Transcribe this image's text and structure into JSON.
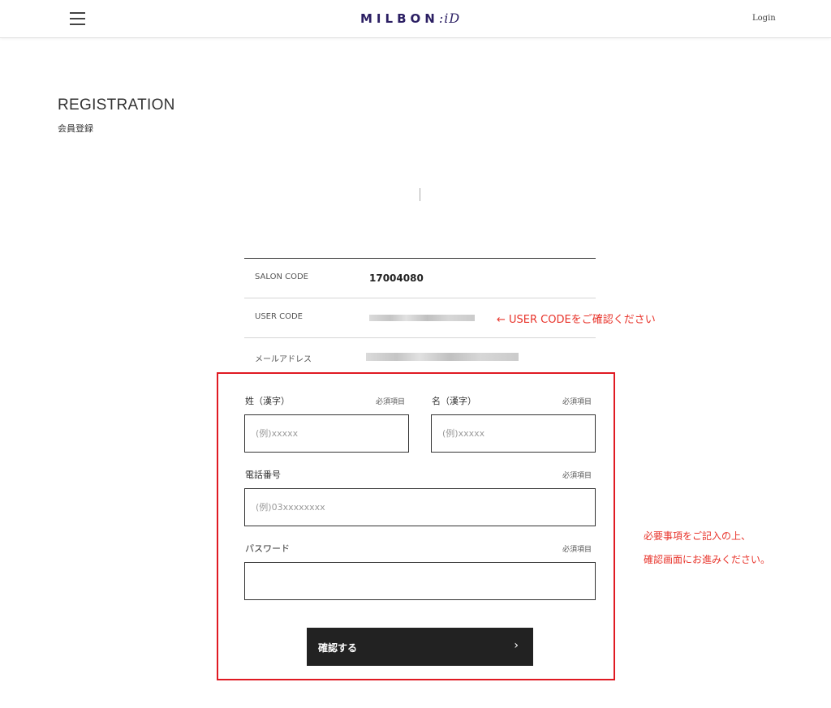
{
  "header": {
    "logo_text_a": "MILBON",
    "logo_text_b": ":iD",
    "login_label": "Login"
  },
  "page": {
    "title": "REGISTRATION",
    "subtitle": "会員登録"
  },
  "info": {
    "salon_code_label": "SALON CODE",
    "salon_code_value": "17004080",
    "user_code_label": "USER CODE",
    "email_label": "メールアドレス"
  },
  "annotations": {
    "user_code_hint": "← USER CODEをご確認ください",
    "form_hint_line1": "必要事項をご記入の上、",
    "form_hint_line2": "確認画面にお進みください。"
  },
  "form": {
    "required_label": "必須項目",
    "last_name_label": "姓（漢字）",
    "last_name_placeholder": "(例)xxxxx",
    "first_name_label": "名（漢字）",
    "first_name_placeholder": "(例)xxxxx",
    "phone_label": "電話番号",
    "phone_placeholder": "(例)03xxxxxxxx",
    "password_label": "パスワード",
    "password_placeholder": "",
    "submit_label": "確認する",
    "submit_arrow": "›"
  },
  "colors": {
    "annotation": "#e8332a",
    "highlight_border": "#e01a22",
    "logo": "#2b1f63",
    "button": "#222222"
  },
  "icons": [
    "hamburger-menu-icon",
    "chevron-right-icon"
  ]
}
